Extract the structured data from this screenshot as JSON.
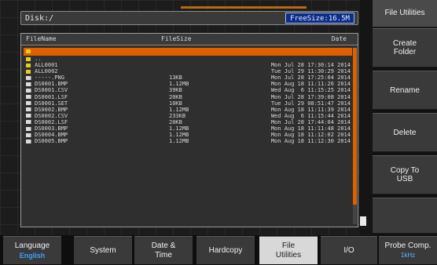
{
  "path": "Disk:/",
  "free_size": "FreeSize:16.5M",
  "header": {
    "name": "FileName",
    "size": "FileSize",
    "date": "Date"
  },
  "rows": [
    {
      "type": "folder",
      "name": "",
      "size": "",
      "date": "",
      "selected": true
    },
    {
      "type": "folder",
      "name": "..",
      "size": "",
      "date": ""
    },
    {
      "type": "folder",
      "name": "ALL0001",
      "size": "",
      "date": "Mon Jul 28 17:30:14 2014"
    },
    {
      "type": "folder",
      "name": "ALL0002",
      "size": "",
      "date": "Tue Jul 29 11:30:29 2014"
    },
    {
      "type": "file",
      "name": "-----.PNG",
      "size": "13KB",
      "date": "Mon Jul 28 17:25:04 2014"
    },
    {
      "type": "file",
      "name": "DS0001.BMP",
      "size": "1.12MB",
      "date": "Mon Aug 18 11:11:26 2014"
    },
    {
      "type": "file",
      "name": "DS0001.CSV",
      "size": "39KB",
      "date": "Wed Aug  6 11:15:25 2014"
    },
    {
      "type": "file",
      "name": "DS0001.LSF",
      "size": "20KB",
      "date": "Mon Jul 28 17:39:08 2014"
    },
    {
      "type": "file",
      "name": "DS0001.SET",
      "size": "10KB",
      "date": "Tue Jul 29 08:51:47 2014"
    },
    {
      "type": "file",
      "name": "DS0002.BMP",
      "size": "1.12MB",
      "date": "Mon Aug 18 11:11:39 2014"
    },
    {
      "type": "file",
      "name": "DS0002.CSV",
      "size": "233KB",
      "date": "Wed Aug  6 11:15:44 2014"
    },
    {
      "type": "file",
      "name": "DS0002.LSF",
      "size": "20KB",
      "date": "Mon Jul 28 17:44:04 2014"
    },
    {
      "type": "file",
      "name": "DS0003.BMP",
      "size": "1.12MB",
      "date": "Mon Aug 18 11:11:48 2014"
    },
    {
      "type": "file",
      "name": "DS0004.BMP",
      "size": "1.12MB",
      "date": "Mon Aug 18 11:12:02 2014"
    },
    {
      "type": "file",
      "name": "DS0005.BMP",
      "size": "1.12MB",
      "date": "Mon Aug 18 11:12:30 2014"
    }
  ],
  "side_menu": {
    "title": "File Utilities",
    "create_folder": "Create\nFolder",
    "rename": "Rename",
    "delete": "Delete",
    "copy_to_usb": "Copy To\nUSB"
  },
  "bottom": {
    "language_label": "Language",
    "language_value": "English",
    "system": "System",
    "date_time": "Date &\nTime",
    "hardcopy": "Hardcopy",
    "file_utilities": "File\nUtilities",
    "io": "I/O",
    "probe_comp_label": "Probe Comp.",
    "probe_comp_value": "1kHz"
  },
  "colors": {
    "selection": "#e06000",
    "folder": "#e6cc22",
    "free_size_bg": "#0c2e86",
    "sub_value": "#3aa0ff"
  }
}
